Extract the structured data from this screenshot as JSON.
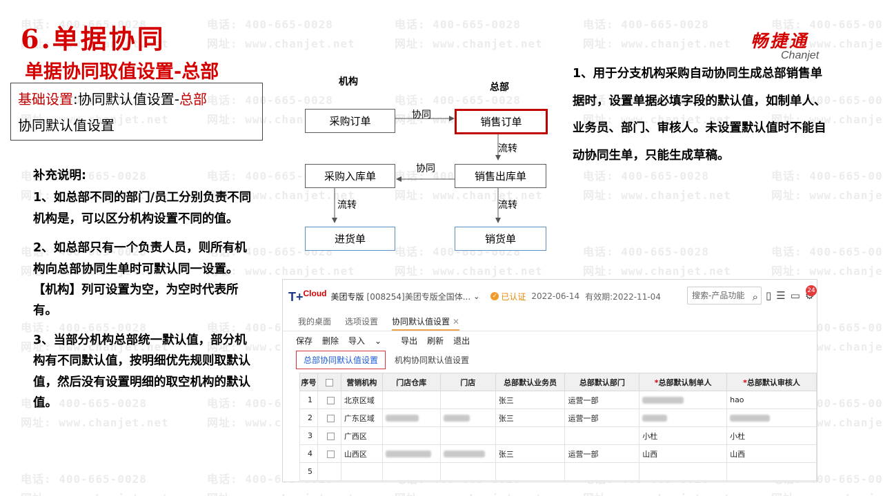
{
  "watermark": {
    "phone": "电话: 400-665-0028",
    "site": "网址: www.chanjet.net"
  },
  "header": {
    "title": "6.单据协同",
    "subtitle": "单据协同取值设置-总部"
  },
  "logo": {
    "cn": "畅捷通",
    "en": "Chanjet"
  },
  "basic": {
    "prefix": "基础设置",
    "colon": ":",
    "mid": "协同默认值设置-",
    "hq": "总部",
    "line2": "协同默认值设置"
  },
  "supplement": {
    "heading": "补充说明:",
    "items": [
      "1、如总部不同的部门/员工分别负责不同机构是，可以区分机构设置不同的值。",
      "2、如总部只有一个负责人员，则所有机构向总部协同生单时可默认同一设置。【机构】列可设置为空，为空时代表所有。",
      "3、当部分机构总部统一默认值，部分机构有不同默认值，按明细优先规则取默认值，然后没有设置明细的取空机构的默认值。"
    ]
  },
  "note": {
    "text": "1、用于分支机构采购自动协同生成总部销售单据时，设置单据必填字段的默认值，如制单人、业务员、部门、审核人。未设置默认值时不能自动协同生单，只能生成草稿。"
  },
  "diagram": {
    "col_left": "机构",
    "col_right": "总部",
    "nodes": {
      "po": "采购订单",
      "so": "销售订单",
      "pin": "采购入库单",
      "sout": "销售出库单",
      "recv": "进货单",
      "sale": "销货单"
    },
    "labels": {
      "sync1": "协同",
      "sync2": "协同",
      "flow1": "流转",
      "flow2": "流转",
      "flow3": "流转"
    }
  },
  "app": {
    "brand": "T+",
    "brand_sup": "Cloud",
    "edition": "美团专版",
    "company": "[008254]美团专版全国体...",
    "verified": "已认证",
    "start_date": "2022-06-14",
    "valid_until": "有效期:2022-11-04",
    "search_placeholder": "搜索-产品功能",
    "notification_count": "24",
    "tabs": [
      "我的桌面",
      "选项设置",
      "协同默认值设置"
    ],
    "toolbar": [
      "保存",
      "删除",
      "导入",
      "导出",
      "刷新",
      "退出"
    ],
    "import_caret": "⌄",
    "subtabs": [
      "总部协同默认值设置",
      "机构协同默认值设置"
    ],
    "columns": [
      "序号",
      "",
      "营销机构",
      "门店仓库",
      "门店",
      "总部默认业务员",
      "总部默认部门",
      "总部默认制单人",
      "总部默认审核人"
    ],
    "rows": [
      {
        "no": "1",
        "org": "北京区域",
        "warehouse": "",
        "store": "",
        "salesman": "张三",
        "dept": "运营一部",
        "maker": "",
        "auditor": "hao"
      },
      {
        "no": "2",
        "org": "广东区域",
        "warehouse": "",
        "store": "",
        "salesman": "张三",
        "dept": "运营一部",
        "maker": "",
        "auditor": ""
      },
      {
        "no": "3",
        "org": "广西区",
        "warehouse": "",
        "store": "",
        "salesman": "",
        "dept": "",
        "maker": "小杜",
        "auditor": "小杜"
      },
      {
        "no": "4",
        "org": "山西区",
        "warehouse": "",
        "store": "",
        "salesman": "张三",
        "dept": "运营一部",
        "maker": "山西",
        "auditor": "山西"
      },
      {
        "no": "5",
        "org": "",
        "warehouse": "",
        "store": "",
        "salesman": "",
        "dept": "",
        "maker": "",
        "auditor": ""
      }
    ]
  },
  "colors": {
    "brand_red": "#d40000",
    "highlight_box": "#c00000",
    "link_blue": "#1f5bd6"
  }
}
